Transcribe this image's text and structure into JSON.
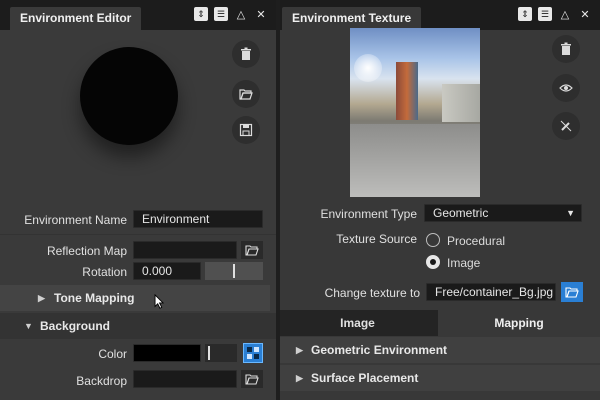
{
  "left_panel": {
    "title": "Environment Editor",
    "env_name_label": "Environment Name",
    "env_name_value": "Environment",
    "reflection_map_label": "Reflection Map",
    "reflection_map_value": "",
    "rotation_label": "Rotation",
    "rotation_value": "0.000",
    "tone_mapping_label": "Tone Mapping",
    "background_label": "Background",
    "color_label": "Color",
    "backdrop_label": "Backdrop"
  },
  "right_panel": {
    "title": "Environment Texture",
    "env_type_label": "Environment Type",
    "env_type_value": "Geometric",
    "texture_source_label": "Texture Source",
    "texture_source_options": [
      "Procedural",
      "Image"
    ],
    "texture_source_selected": "Image",
    "change_texture_label": "Change texture to",
    "change_texture_value": "Free/container_Bg.jpg",
    "tabs": [
      "Image",
      "Mapping"
    ],
    "active_tab": "Mapping",
    "sections": [
      "Geometric Environment",
      "Surface Placement"
    ]
  },
  "colors": {
    "panel_bg": "#3a3a3a",
    "tabbar_bg": "#1c1c1c",
    "accent_blue": "#4aa3ff",
    "field_bg": "#1a1a1a"
  },
  "icons": [
    "sort-icon",
    "menu-icon",
    "maximize-icon",
    "close-icon",
    "trash-icon",
    "folder-open-icon",
    "save-icon",
    "eye-icon",
    "no-brush-icon",
    "caret-down-icon",
    "caret-right-icon",
    "color-picker-icon",
    "cursor-icon"
  ]
}
